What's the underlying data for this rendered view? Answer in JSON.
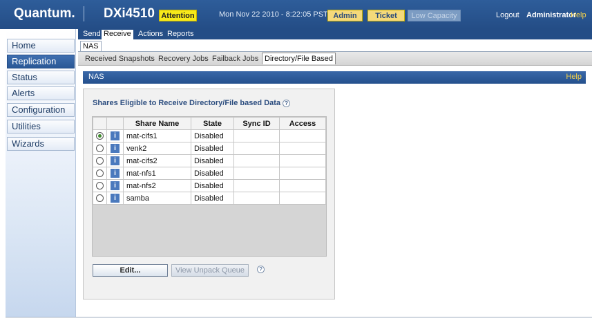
{
  "header": {
    "brand": "Quantum.",
    "product": "DXi4510",
    "attention": "Attention",
    "datetime": "Mon Nov 22 2010 - 8:22:05 PST",
    "admin": "Admin",
    "ticket": "Ticket",
    "low_capacity": "Low Capacity",
    "logout": "Logout",
    "user": "Administrator",
    "help": "Help"
  },
  "sidebar": {
    "items": [
      {
        "label": "Home"
      },
      {
        "label": "Replication"
      },
      {
        "label": "Status"
      },
      {
        "label": "Alerts"
      },
      {
        "label": "Configuration"
      },
      {
        "label": "Utilities"
      },
      {
        "label": "Wizards"
      }
    ]
  },
  "tabs_main": [
    {
      "label": "Send"
    },
    {
      "label": "Receive"
    },
    {
      "label": "Actions"
    },
    {
      "label": "Reports"
    }
  ],
  "tab_nas": "NAS",
  "tabs_sub": [
    {
      "label": "Received Snapshots"
    },
    {
      "label": "Recovery Jobs"
    },
    {
      "label": "Failback Jobs"
    },
    {
      "label": "Directory/File Based"
    }
  ],
  "section": {
    "title": "NAS",
    "help": "Help"
  },
  "panel": {
    "title": "Shares Eligible to Receive Directory/File based Data",
    "help_symbol": "?",
    "columns": [
      "Share Name",
      "State",
      "Sync ID",
      "Access"
    ],
    "rows": [
      {
        "name": "mat-cifs1",
        "state": "Disabled",
        "sync_id": "",
        "access": "",
        "selected": true
      },
      {
        "name": "venk2",
        "state": "Disabled",
        "sync_id": "",
        "access": "",
        "selected": false
      },
      {
        "name": "mat-cifs2",
        "state": "Disabled",
        "sync_id": "",
        "access": "",
        "selected": false
      },
      {
        "name": "mat-nfs1",
        "state": "Disabled",
        "sync_id": "",
        "access": "",
        "selected": false
      },
      {
        "name": "mat-nfs2",
        "state": "Disabled",
        "sync_id": "",
        "access": "",
        "selected": false
      },
      {
        "name": "samba",
        "state": "Disabled",
        "sync_id": "",
        "access": "",
        "selected": false
      }
    ],
    "info_symbol": "i",
    "edit_button": "Edit...",
    "unpack_button": "View Unpack Queue"
  },
  "colors": {
    "header_blue": "#2e5d9a",
    "attention_yellow": "#f7ea1a",
    "active_nav": "#2a5896"
  }
}
